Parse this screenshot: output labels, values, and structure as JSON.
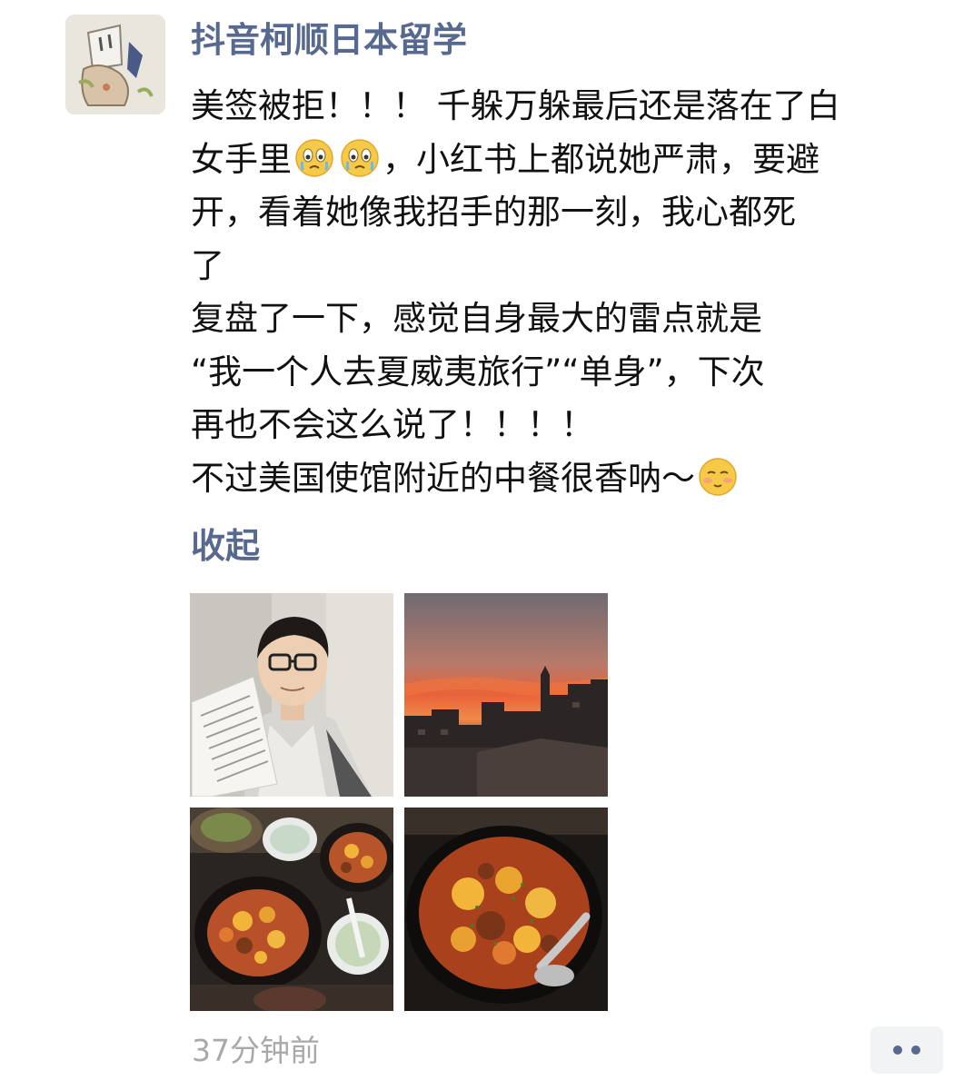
{
  "post": {
    "username": "抖音柯顺日本留学",
    "lines": [
      "美签被拒！！！ 千躲万躲最后还是落在了白",
      "女手里",
      "，小红书上都说她严肃，要避",
      "开，看着她像我招手的那一刻，我心都死",
      "了",
      "复盘了一下，感觉自身最大的雷点就是",
      "“我一个人去夏威夷旅行”“单身”，下次",
      "再也不会这么说了！！！！",
      "不过美国使馆附近的中餐很香呐～"
    ],
    "collapse_label": "收起",
    "timestamp": "37分钟前"
  },
  "icons": {
    "crying_emoji": "crying-face-emoji",
    "blush_emoji": "pleading-face-emoji",
    "more_actions": "more-dots-icon"
  },
  "colors": {
    "link": "#57698f",
    "text": "#111111",
    "meta": "#a9a9a9",
    "action_bg": "#f2f3f5"
  }
}
